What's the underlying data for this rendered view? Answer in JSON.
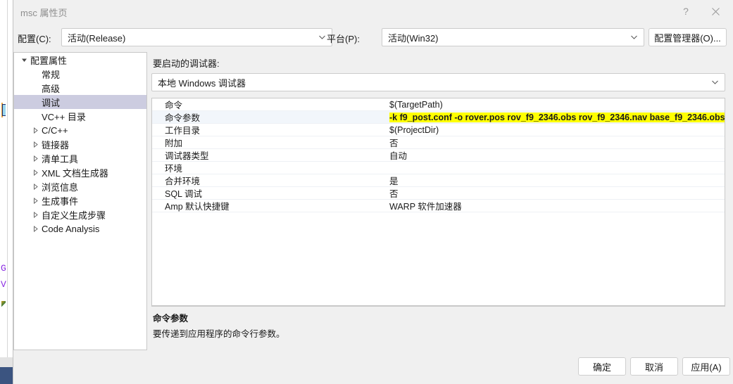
{
  "window": {
    "title": "msc 属性页",
    "help_icon": "question-mark-icon",
    "close_icon": "close-icon"
  },
  "config_bar": {
    "configuration_label": "配置(C):",
    "configuration_value": "活动(Release)",
    "platform_label": "平台(P):",
    "platform_value": "活动(Win32)",
    "config_manager_button": "配置管理器(O)..."
  },
  "tree": {
    "items": [
      {
        "label": "配置属性",
        "level": 0,
        "expanded": true,
        "has_arrow": true,
        "selected": false
      },
      {
        "label": "常规",
        "level": 1,
        "expanded": false,
        "has_arrow": false,
        "selected": false
      },
      {
        "label": "高级",
        "level": 1,
        "expanded": false,
        "has_arrow": false,
        "selected": false
      },
      {
        "label": "调试",
        "level": 1,
        "expanded": false,
        "has_arrow": false,
        "selected": true
      },
      {
        "label": "VC++ 目录",
        "level": 1,
        "expanded": false,
        "has_arrow": false,
        "selected": false
      },
      {
        "label": "C/C++",
        "level": 1,
        "expanded": false,
        "has_arrow": true,
        "selected": false
      },
      {
        "label": "链接器",
        "level": 1,
        "expanded": false,
        "has_arrow": true,
        "selected": false
      },
      {
        "label": "清单工具",
        "level": 1,
        "expanded": false,
        "has_arrow": true,
        "selected": false
      },
      {
        "label": "XML 文档生成器",
        "level": 1,
        "expanded": false,
        "has_arrow": true,
        "selected": false
      },
      {
        "label": "浏览信息",
        "level": 1,
        "expanded": false,
        "has_arrow": true,
        "selected": false
      },
      {
        "label": "生成事件",
        "level": 1,
        "expanded": false,
        "has_arrow": true,
        "selected": false
      },
      {
        "label": "自定义生成步骤",
        "level": 1,
        "expanded": false,
        "has_arrow": true,
        "selected": false
      },
      {
        "label": "Code Analysis",
        "level": 1,
        "expanded": false,
        "has_arrow": true,
        "selected": false
      }
    ]
  },
  "main": {
    "debugger_label": "要启动的调试器:",
    "debugger_value": "本地 Windows 调试器",
    "properties": [
      {
        "name": "命令",
        "value": "$(TargetPath)",
        "selected": false,
        "highlighted": false
      },
      {
        "name": "命令参数",
        "value": "-k f9_post.conf -o rover.pos rov_f9_2346.obs rov_f9_2346.nav base_f9_2346.obs",
        "selected": true,
        "highlighted": true
      },
      {
        "name": "工作目录",
        "value": "$(ProjectDir)",
        "selected": false,
        "highlighted": false
      },
      {
        "name": "附加",
        "value": "否",
        "selected": false,
        "highlighted": false
      },
      {
        "name": "调试器类型",
        "value": "自动",
        "selected": false,
        "highlighted": false
      },
      {
        "name": "环境",
        "value": "",
        "selected": false,
        "highlighted": false
      },
      {
        "name": "合并环境",
        "value": "是",
        "selected": false,
        "highlighted": false
      },
      {
        "name": "SQL 调试",
        "value": "否",
        "selected": false,
        "highlighted": false
      },
      {
        "name": "Amp 默认快捷键",
        "value": "WARP 软件加速器",
        "selected": false,
        "highlighted": false
      }
    ],
    "description": {
      "title": "命令参数",
      "body": "要传递到应用程序的命令行参数。"
    }
  },
  "footer": {
    "ok_label": "确定",
    "cancel_label": "取消",
    "apply_label": "应用(A)"
  },
  "colors": {
    "highlight": "#ffff00",
    "selection": "#cccce0",
    "row_selection": "#f2f6fb",
    "dialog_bg": "#f0f0f0"
  }
}
